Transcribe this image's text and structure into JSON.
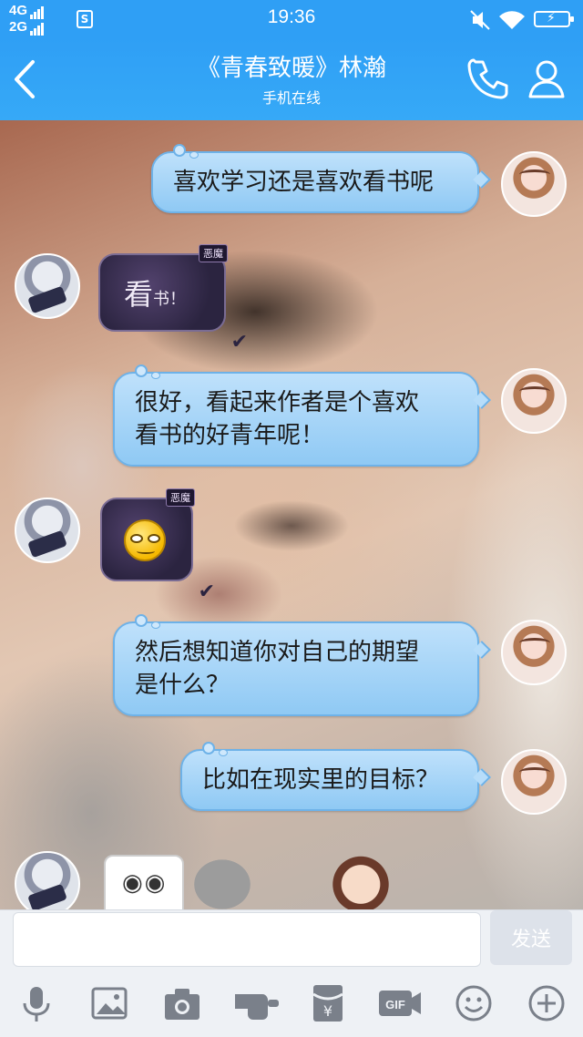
{
  "status_bar": {
    "network_top": "4G",
    "network_bottom": "2G",
    "sim_badge": "S",
    "time": "19:36",
    "icons": [
      "signal-bars-icon",
      "mute-icon",
      "wifi-icon",
      "battery-charging-icon"
    ]
  },
  "header": {
    "back_icon": "chevron-left-icon",
    "title": "《青春致暖》林瀚",
    "subtitle": "手机在线",
    "call_icon": "phone-icon",
    "profile_icon": "person-icon",
    "color": "#2f9ff5"
  },
  "messages": [
    {
      "side": "out",
      "text": "喜欢学习还是喜欢看书呢"
    },
    {
      "side": "in",
      "badge": "恶魔",
      "text_main": "看",
      "text_small": "书！"
    },
    {
      "side": "out",
      "text_line1": "很好，看起来作者是个喜欢",
      "text_line2": "看书的好青年呢！"
    },
    {
      "side": "in",
      "badge": "恶魔",
      "emoji": "smirk-emoji"
    },
    {
      "side": "out",
      "text_line1": "然后想知道你对自己的期望",
      "text_line2": "是什么？"
    },
    {
      "side": "out",
      "text": "比如在现实里的目标？"
    }
  ],
  "stickers": [
    "meme-face-sticker",
    "ghost-sticker",
    "cartoon-girl-sticker"
  ],
  "composer": {
    "placeholder": "",
    "send_label": "发送"
  },
  "toolbar": [
    "microphone-icon",
    "image-icon",
    "camera-icon",
    "poke-hand-icon",
    "red-packet-icon",
    "gif-icon",
    "emoji-icon",
    "plus-icon"
  ]
}
